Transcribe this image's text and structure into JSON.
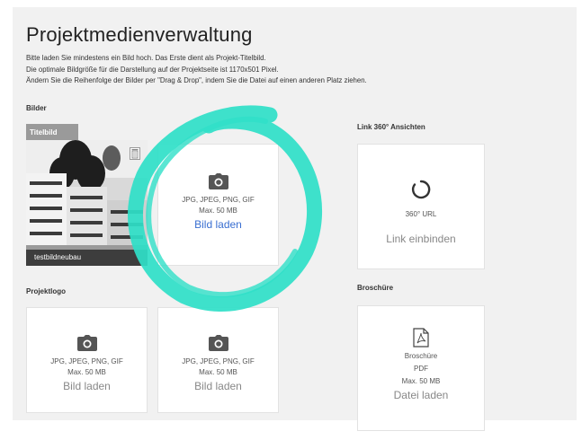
{
  "header": {
    "title": "Projektmedienverwaltung",
    "intro": [
      "Bitte laden Sie mindestens ein Bild hoch. Das Erste dient als Projekt-Titelbild.",
      "Die optimale Bildgröße für die Darstellung auf der Projektseite ist 1170x501 Pixel.",
      "Ändern Sie die Reihenfolge der Bilder per \"Drag & Drop\", indem Sie die Datei auf einen anderen Platz ziehen."
    ]
  },
  "bilder": {
    "label": "Bilder",
    "title_image": {
      "tag": "Titelbild",
      "filename": "testbildneubau"
    },
    "upload": {
      "formats": "JPG, JPEG, PNG, GIF",
      "max": "Max. 50 MB",
      "action": "Bild laden"
    }
  },
  "link360": {
    "label": "Link 360° Ansichten",
    "caption": "360° URL",
    "action": "Link einbinden"
  },
  "projektlogo": {
    "label": "Projektlogo",
    "slots": [
      {
        "formats": "JPG, JPEG, PNG, GIF",
        "max": "Max. 50 MB",
        "action": "Bild laden"
      },
      {
        "formats": "JPG, JPEG, PNG, GIF",
        "max": "Max. 50 MB",
        "action": "Bild laden"
      }
    ]
  },
  "broschuere": {
    "label": "Broschüre",
    "name": "Broschüre",
    "format": "PDF",
    "max": "Max. 50 MB",
    "action": "Datei laden"
  },
  "colors": {
    "highlight": "#2fe0c8",
    "link": "#3a6fd1",
    "panel": "#f1f1f1"
  }
}
